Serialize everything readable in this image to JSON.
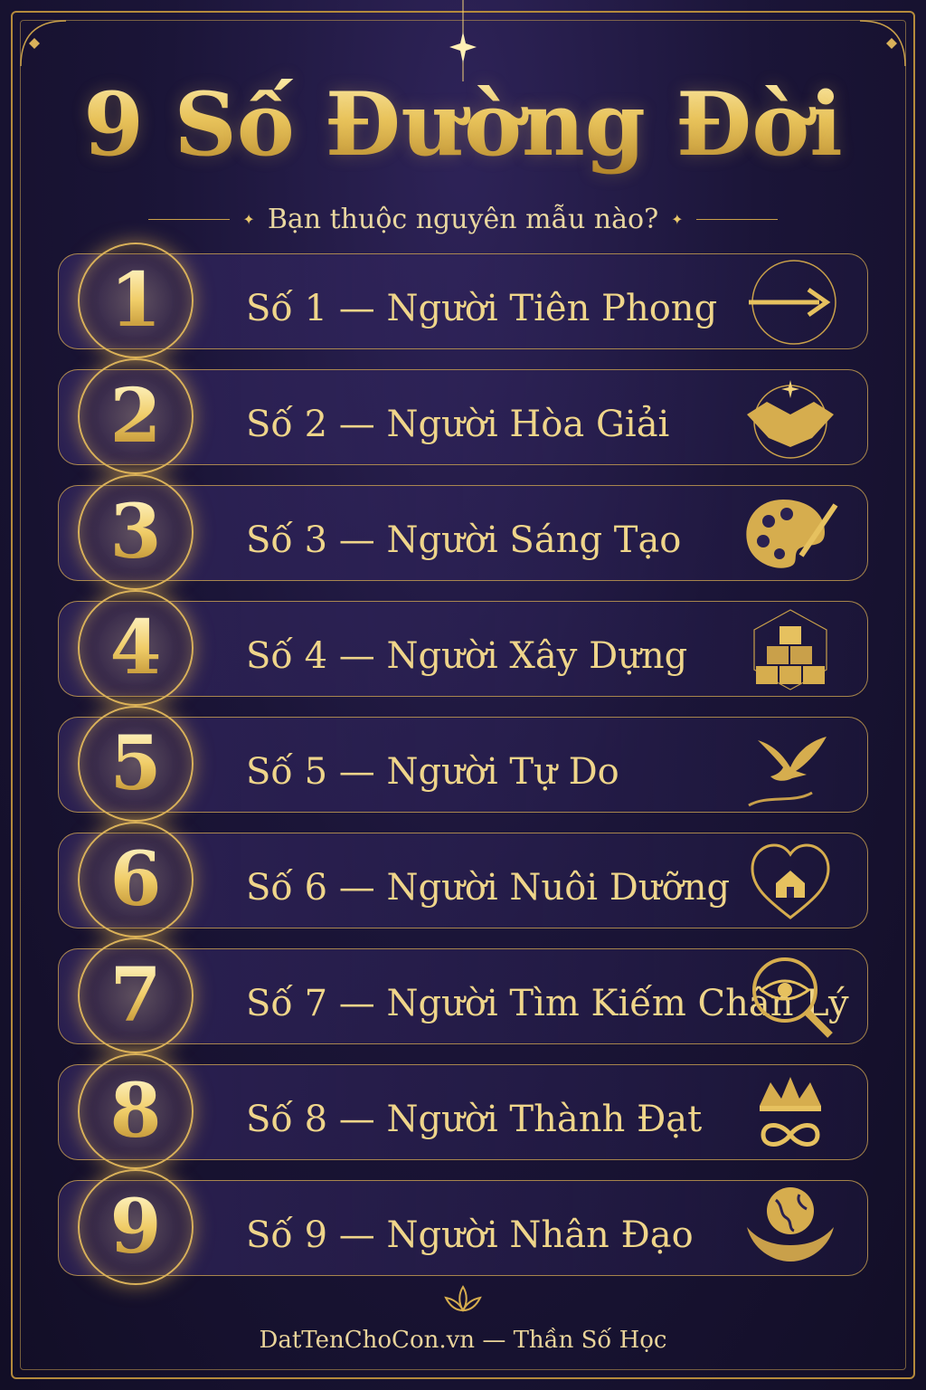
{
  "title": "9 Số Đường Đời",
  "subtitle": "Bạn thuộc nguyên mẫu nào?",
  "items": [
    {
      "number": "1",
      "label": "Số 1 — Người Tiên Phong",
      "icon": "arrow-icon"
    },
    {
      "number": "2",
      "label": "Số 2 — Người Hòa Giải",
      "icon": "handshake-icon"
    },
    {
      "number": "3",
      "label": "Số 3 — Người Sáng Tạo",
      "icon": "palette-icon"
    },
    {
      "number": "4",
      "label": "Số 4 — Người Xây Dựng",
      "icon": "blocks-icon"
    },
    {
      "number": "5",
      "label": "Số 5 — Người Tự Do",
      "icon": "bird-icon"
    },
    {
      "number": "6",
      "label": "Số 6 — Người Nuôi Dưỡng",
      "icon": "heart-home-icon"
    },
    {
      "number": "7",
      "label": "Số 7 — Người Tìm Kiếm Chân Lý",
      "icon": "eye-magnifier-icon"
    },
    {
      "number": "8",
      "label": "Số 8 — Người Thành Đạt",
      "icon": "crown-infinity-icon"
    },
    {
      "number": "9",
      "label": "Số 9 — Người Nhân Đạo",
      "icon": "globe-hands-icon"
    }
  ],
  "footer": "DatTenChoCon.vn — Thần Số Học",
  "colors": {
    "gold": "#e9c76a",
    "background": "#1b1538",
    "border": "#d4aa50"
  }
}
